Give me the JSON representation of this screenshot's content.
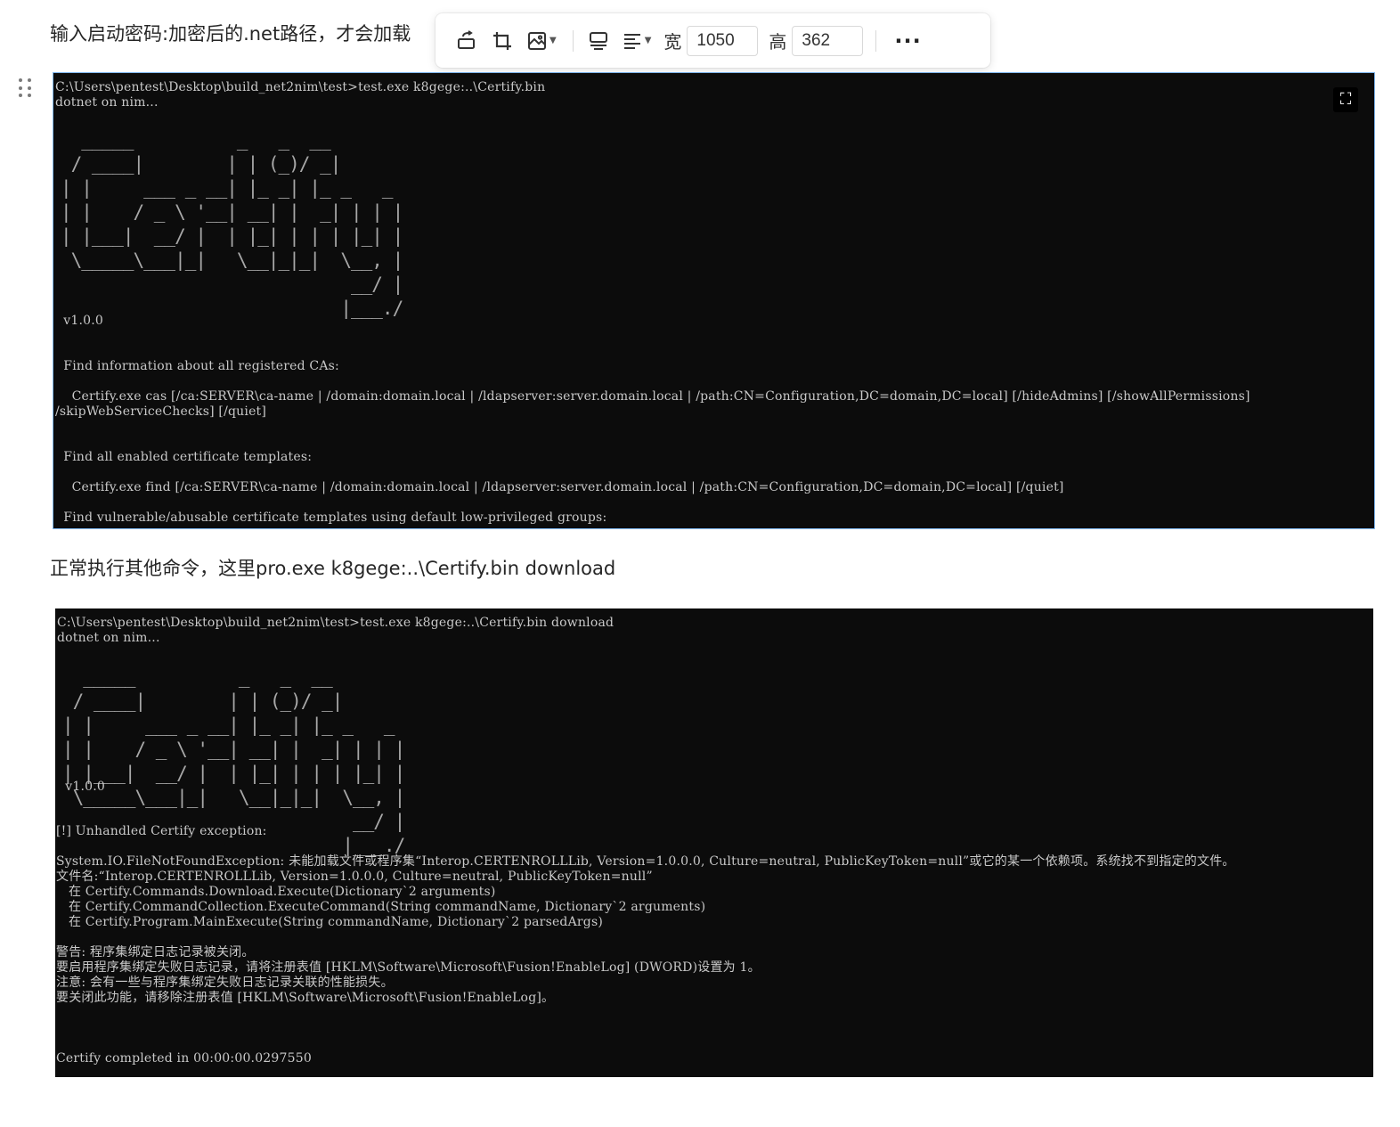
{
  "article": {
    "para1": "输入启动密码:加密后的.net路径，才会加载",
    "para2": "正常执行其他命令，这里pro.exe k8gege:..\\Certify.bin download"
  },
  "toolbar": {
    "width_label": "宽",
    "width_value": "1050",
    "height_label": "高",
    "height_value": "362",
    "icons": [
      "rotate-icon",
      "crop-icon",
      "image-style-icon",
      "caption-icon",
      "align-left-icon",
      "more-icon"
    ]
  },
  "screenshot1": {
    "prompt": "C:\\Users\\pentest\\Desktop\\build_net2nim\\test>test.exe k8gege:..\\Certify.bin",
    "line2": "dotnet on nim...",
    "logo": "  _____          _   _  __ \n / ____|        | | (_)/ _|\n| |     ___ _ __| |_ _| |_ _   _\n| |    / _ \\ '__| __| |  _| | | |\n| |___|  __/ |  | |_| | | | |_| |\n \\_____\\___|_|   \\__|_|_|  \\__, |\n                            __/ |\n                           |___./",
    "version": "  v1.0.0",
    "body": "  Find information about all registered CAs:\n\n    Certify.exe cas [/ca:SERVER\\ca-name | /domain:domain.local | /ldapserver:server.domain.local | /path:CN=Configuration,DC=domain,DC=local] [/hideAdmins] [/showAllPermissions]\n/skipWebServiceChecks] [/quiet]\n\n\n  Find all enabled certificate templates:\n\n    Certify.exe find [/ca:SERVER\\ca-name | /domain:domain.local | /ldapserver:server.domain.local | /path:CN=Configuration,DC=domain,DC=local] [/quiet]\n\n  Find vulnerable/abusable certificate templates using default low-privileged groups:\n\n    Certify.exe find /vulnerable [/ca:SERVER\\ca-name | /domain:domain.local | /ldapserver:server.domain.local | /path:CN=Configuration,DC=domain,DC=local] [/quiet]\n\n  Find vulnerable/abusable certificate templates using all groups the current user context is a part of:"
  },
  "screenshot2": {
    "prompt": "C:\\Users\\pentest\\Desktop\\build_net2nim\\test>test.exe k8gege:..\\Certify.bin download",
    "line2": "dotnet on nim...",
    "logo": "  _____          _   _  __ \n / ____|        | | (_)/ _|\n| |     ___ _ __| |_ _| |_ _   _\n| |    / _ \\ '__| __| |  _| | | |\n| |___|  __/ |  | |_| | | | |_| |\n \\_____\\___|_|   \\__|_|_|  \\__, |\n                            __/ |\n                           |___./",
    "version": "  v1.0.0",
    "body": "[!] Unhandled Certify exception:\n\nSystem.IO.FileNotFoundException: 未能加载文件或程序集“Interop.CERTENROLLLib, Version=1.0.0.0, Culture=neutral, PublicKeyToken=null”或它的某一个依赖项。系统找不到指定的文件。\n文件名:“Interop.CERTENROLLLib, Version=1.0.0.0, Culture=neutral, PublicKeyToken=null”\n   在 Certify.Commands.Download.Execute(Dictionary`2 arguments)\n   在 Certify.CommandCollection.ExecuteCommand(String commandName, Dictionary`2 arguments)\n   在 Certify.Program.MainExecute(String commandName, Dictionary`2 parsedArgs)\n\n警告: 程序集绑定日志记录被关闭。\n要启用程序集绑定失败日志记录，请将注册表值 [HKLM\\Software\\Microsoft\\Fusion!EnableLog] (DWORD)设置为 1。\n注意: 会有一些与程序集绑定失败日志记录关联的性能损失。\n要关闭此功能，请移除注册表值 [HKLM\\Software\\Microsoft\\Fusion!EnableLog]。\n\n\n\nCertify completed in 00:00:00.0297550"
  }
}
